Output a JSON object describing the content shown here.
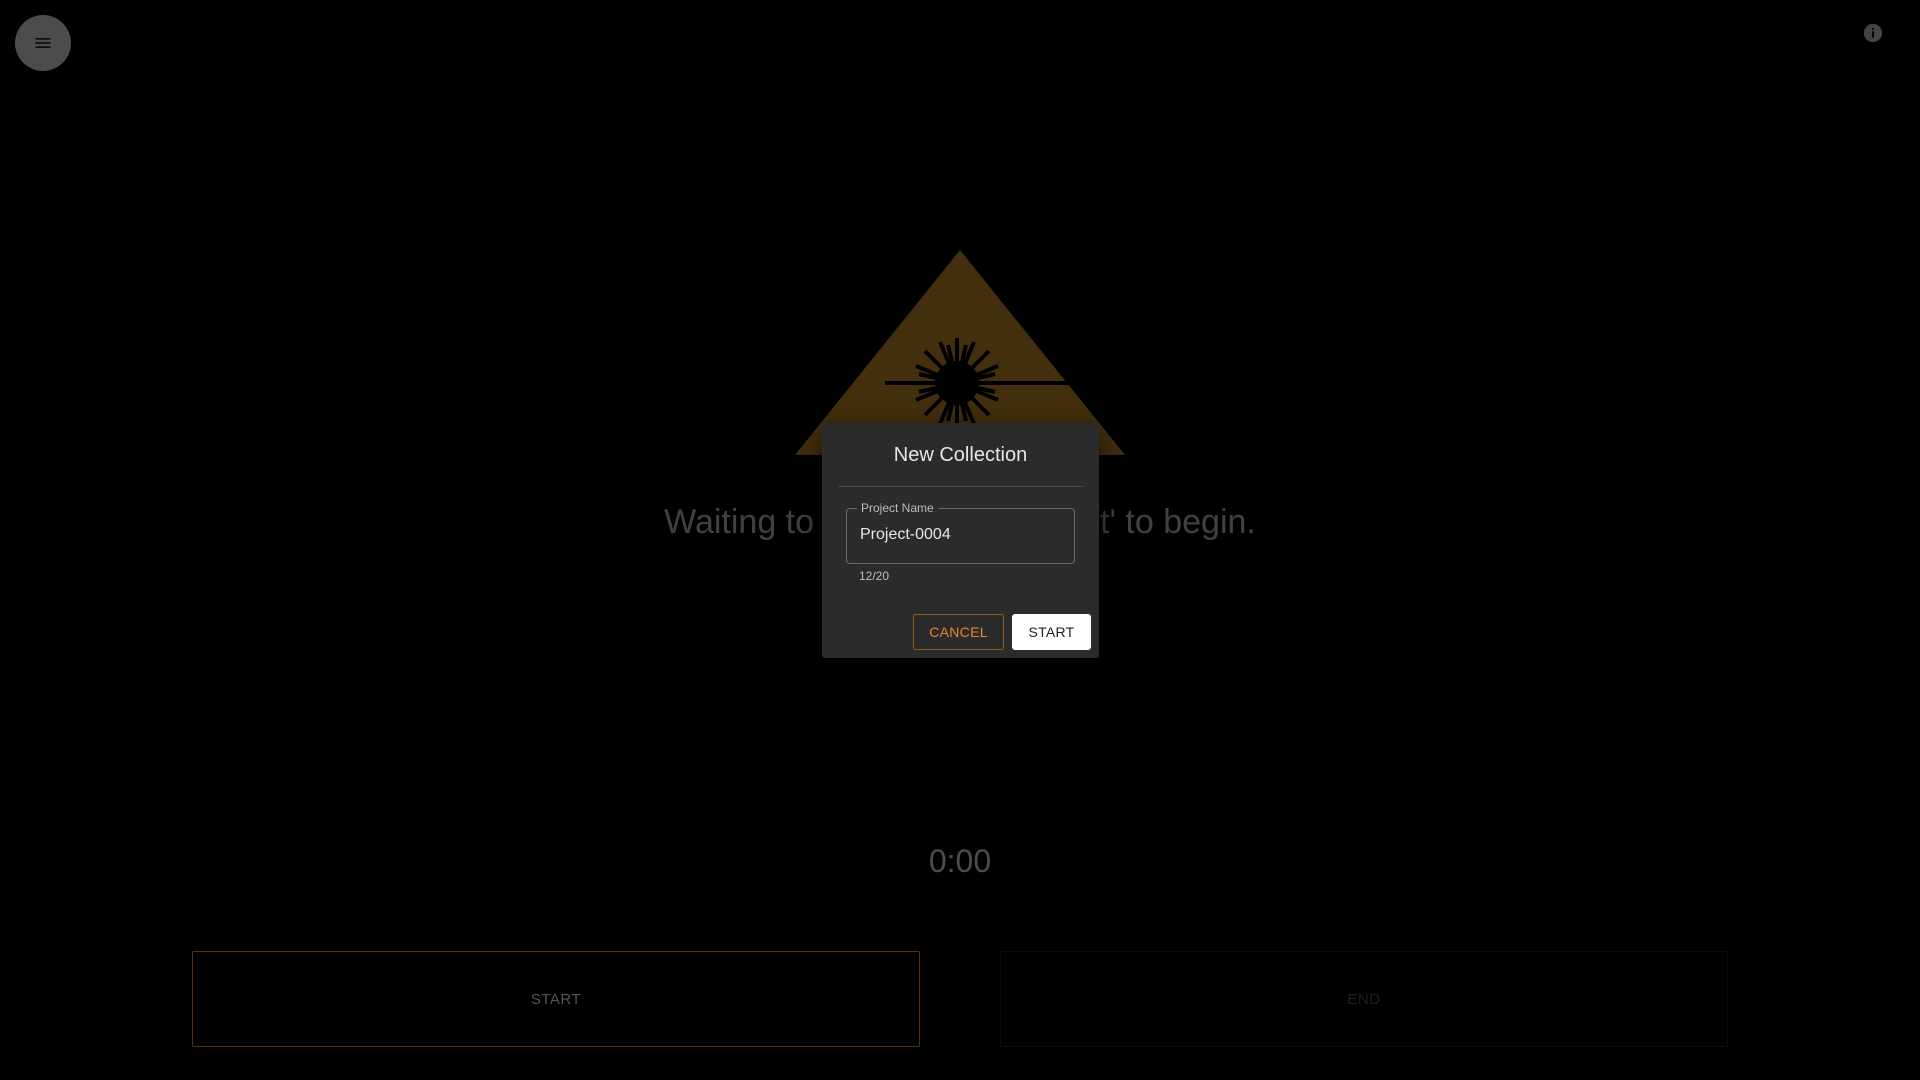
{
  "status": {
    "message_left": "Waiting to",
    "message_right": "t' to begin."
  },
  "timer": {
    "value": "0:00"
  },
  "controls": {
    "start_label": "START",
    "end_label": "END"
  },
  "dialog": {
    "title": "New Collection",
    "field_label": "Project Name",
    "field_value": "Project-0004",
    "char_counter": "12/20",
    "cancel_label": "CANCEL",
    "start_label": "START"
  },
  "colors": {
    "accent": "#e3872a",
    "warning_sign": "#7a5718",
    "background": "#000000",
    "dialog_bg": "#2b2b2b"
  },
  "icons": {
    "menu": "hamburger-menu-icon",
    "info": "info-icon",
    "warning": "laser-warning-icon"
  }
}
